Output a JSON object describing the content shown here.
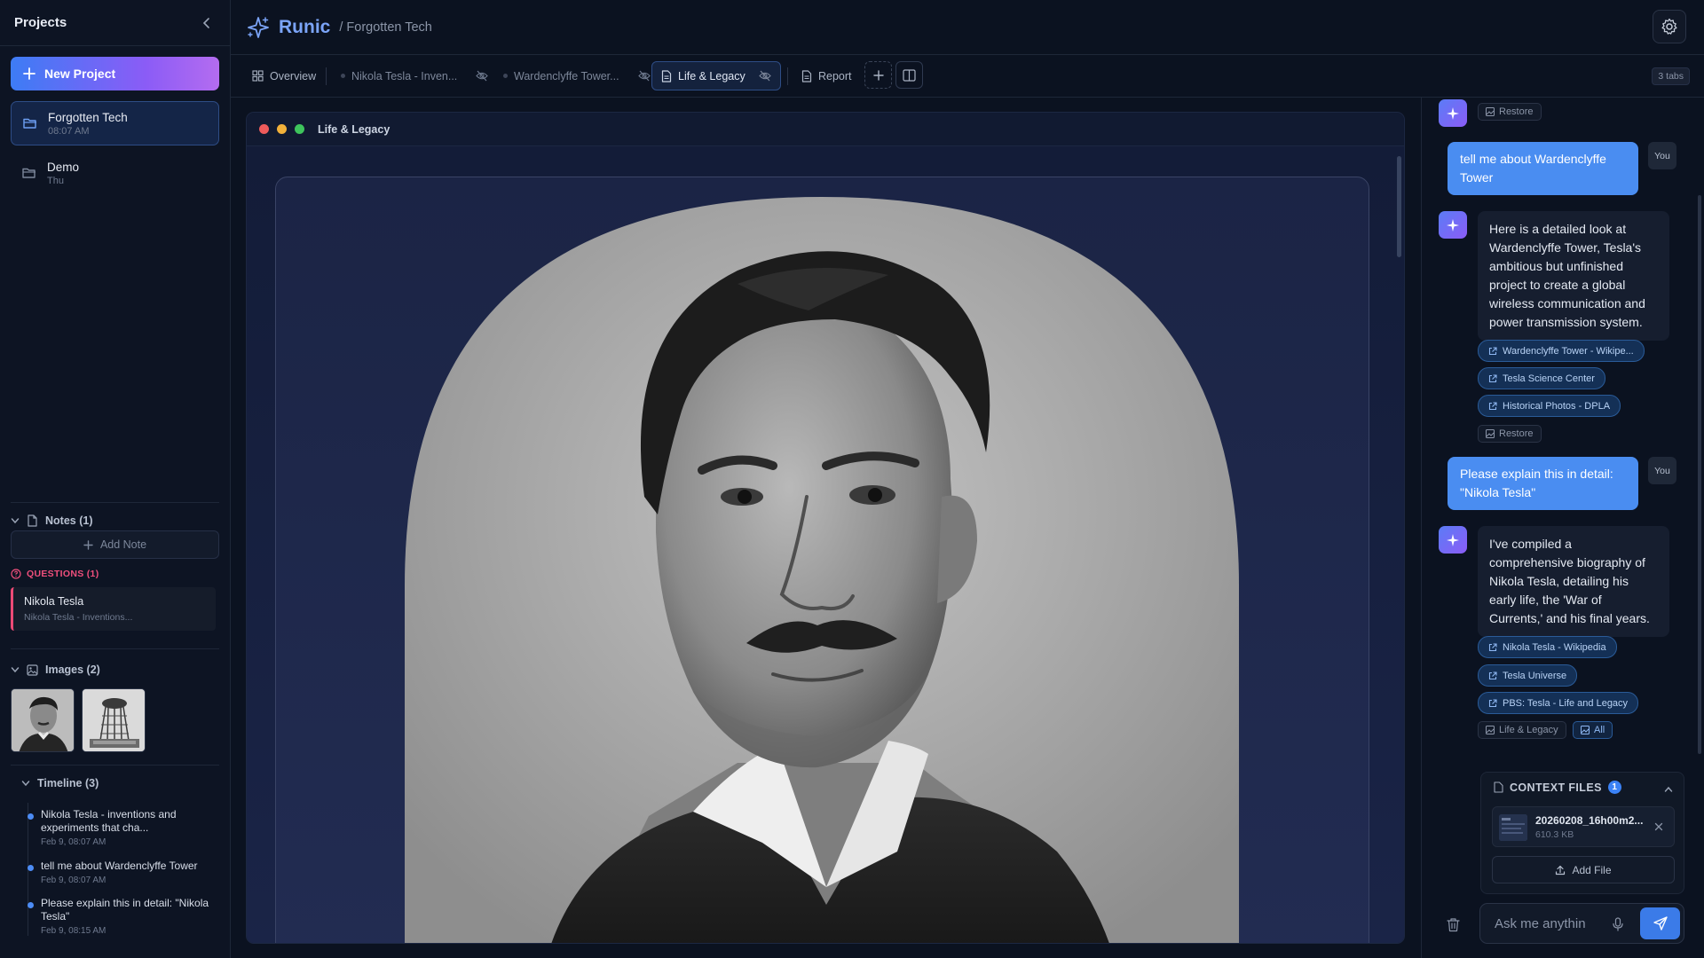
{
  "sidebar": {
    "title": "Projects",
    "new_project_label": "New Project",
    "projects": [
      {
        "name": "Forgotten Tech",
        "time": "08:07 AM",
        "active": true
      },
      {
        "name": "Demo",
        "time": "Thu",
        "active": false
      }
    ],
    "notes_label": "Notes (1)",
    "add_note_label": "Add Note",
    "questions_label": "QUESTIONS (1)",
    "questions": [
      {
        "title": "Nikola Tesla",
        "subtitle": "Nikola Tesla - Inventions..."
      }
    ],
    "images_label": "Images (2)",
    "timeline_label": "Timeline (3)",
    "timeline": [
      {
        "text": "Nikola Tesla - inventions and experiments that cha...",
        "time": "Feb 9, 08:07 AM"
      },
      {
        "text": "tell me about Wardenclyffe Tower",
        "time": "Feb 9, 08:07 AM"
      },
      {
        "text": "Please explain this in detail: \"Nikola Tesla\"",
        "time": "Feb 9, 08:15 AM"
      }
    ]
  },
  "header": {
    "brand": "Runic",
    "breadcrumb": "/ Forgotten Tech"
  },
  "tabs": {
    "items": [
      {
        "label": "Overview"
      },
      {
        "label": "Nikola Tesla - Inven..."
      },
      {
        "label": "Wardenclyffe Tower..."
      },
      {
        "label": "Life & Legacy",
        "active": true
      },
      {
        "label": "Report"
      }
    ],
    "count_label": "3 tabs"
  },
  "document": {
    "title": "Life & Legacy"
  },
  "chat": {
    "messages": [
      {
        "role": "tag",
        "label": "Restore"
      },
      {
        "role": "user",
        "text": "tell me about Wardenclyffe Tower",
        "badge": "You"
      },
      {
        "role": "assistant",
        "text": "Here is a detailed look at Wardenclyffe Tower, Tesla's ambitious but unfinished project to create a global wireless communication and power transmission system.",
        "sources": [
          "Wardenclyffe Tower - Wikipe...",
          "Tesla Science Center",
          "Historical Photos - DPLA"
        ],
        "tags": [
          "Restore"
        ]
      },
      {
        "role": "user",
        "text": "Please explain this in detail: \"Nikola Tesla\"",
        "badge": "You"
      },
      {
        "role": "assistant",
        "text": "I've compiled a comprehensive biography of Nikola Tesla, detailing his early life, the 'War of Currents,' and his final years.",
        "sources": [
          "Nikola Tesla - Wikipedia",
          "Tesla Universe",
          "PBS: Tesla - Life and Legacy"
        ],
        "tags": [
          "Life & Legacy",
          "All"
        ]
      }
    ],
    "context_files": {
      "label": "CONTEXT FILES",
      "count": "1",
      "files": [
        {
          "name": "20260208_16h00m2...",
          "size": "610.3 KB"
        }
      ],
      "add_file_label": "Add File"
    },
    "input_placeholder": "Ask me anythin"
  },
  "colors": {
    "accent": "#4a8df1",
    "brand": "#7ba4f8",
    "question_accent": "#ec4a76",
    "background": "#0b1220"
  }
}
